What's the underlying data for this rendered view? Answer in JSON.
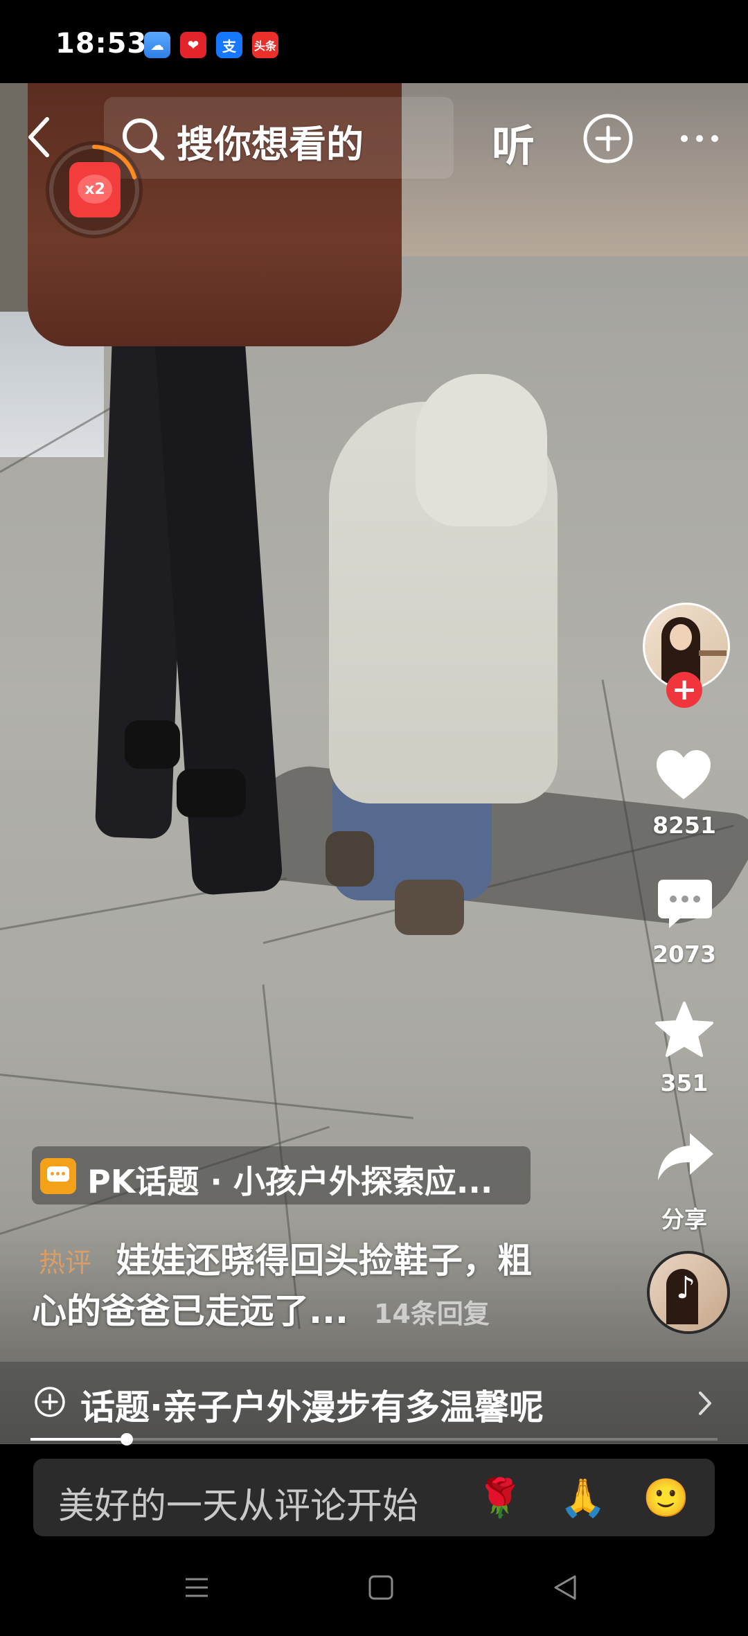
{
  "status_bar": {
    "time": "18:53",
    "app_icons": [
      {
        "name": "weather-app-icon",
        "glyph": "☁"
      },
      {
        "name": "health-app-icon",
        "glyph": "❤"
      },
      {
        "name": "alipay-app-icon",
        "glyph": "支"
      },
      {
        "name": "toutiao-app-icon",
        "glyph": "头条"
      }
    ]
  },
  "top_bar": {
    "search_placeholder": "搜你想看的",
    "listen_label": "听"
  },
  "red_packet": {
    "multiplier": "x2"
  },
  "actions": {
    "likes": "8251",
    "comments": "2073",
    "favorites": "351",
    "share_label": "分享"
  },
  "overlay": {
    "pk_topic": "PK话题 · 小孩户外探索应...",
    "hot_tag": "热评",
    "comment_line1": "娃娃还晓得回头捡鞋子，粗",
    "comment_line2": "心的爸爸已走远了...",
    "reply_count": "14条回复",
    "topic": "话题·亲子户外漫步有多温馨呢"
  },
  "playback": {
    "progress_fraction": 0.14
  },
  "comment_input": {
    "placeholder": "美好的一天从评论开始",
    "emojis": [
      "🌹",
      "🙏",
      "🙂"
    ]
  },
  "colors": {
    "follow_red": "#f0353d",
    "hot_tag": "#e6a060",
    "pk_icon": "#f4a11a"
  }
}
